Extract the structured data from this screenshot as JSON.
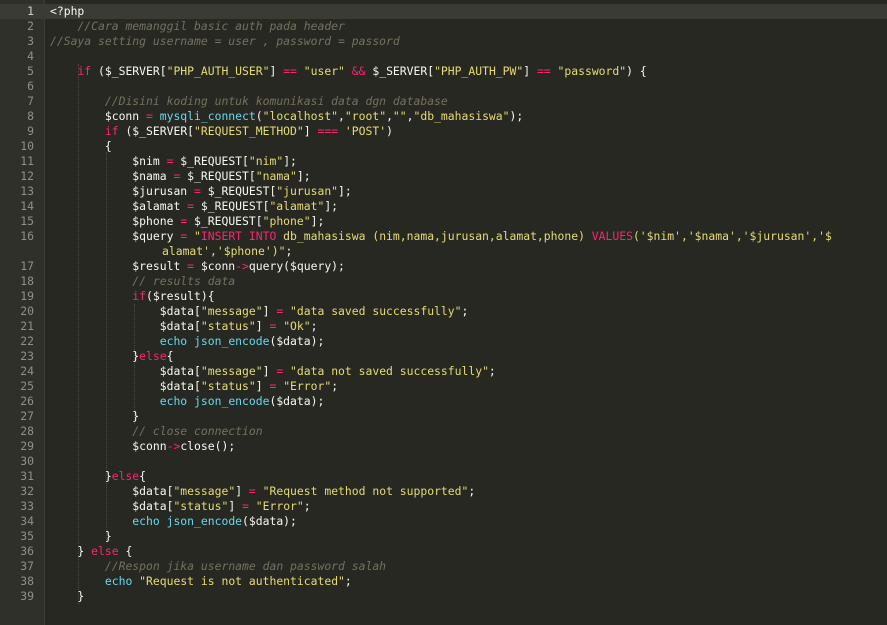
{
  "editor": {
    "lines": [
      {
        "n": "1",
        "t": [
          [
            "v",
            "<?php"
          ]
        ]
      },
      {
        "n": "2",
        "t": [
          [
            "v",
            "    "
          ],
          [
            "c",
            "//Cara memanggil basic auth pada header"
          ]
        ]
      },
      {
        "n": "3",
        "t": [
          [
            "c",
            "//Saya setting username = user , password = passord"
          ]
        ]
      },
      {
        "n": "4",
        "t": []
      },
      {
        "n": "5",
        "t": [
          [
            "v",
            "    "
          ],
          [
            "k",
            "if"
          ],
          [
            "v",
            " ($_SERVER["
          ],
          [
            "s",
            "\"PHP_AUTH_USER\""
          ],
          [
            "v",
            "] "
          ],
          [
            "k",
            "=="
          ],
          [
            "v",
            " "
          ],
          [
            "s",
            "\"user\""
          ],
          [
            "v",
            " "
          ],
          [
            "k",
            "&&"
          ],
          [
            "v",
            " $_SERVER["
          ],
          [
            "s",
            "\"PHP_AUTH_PW\""
          ],
          [
            "v",
            "] "
          ],
          [
            "k",
            "=="
          ],
          [
            "v",
            " "
          ],
          [
            "s",
            "\"password\""
          ],
          [
            "v",
            ") {"
          ]
        ]
      },
      {
        "n": "6",
        "t": []
      },
      {
        "n": "7",
        "t": [
          [
            "v",
            "        "
          ],
          [
            "c",
            "//Disini koding untuk komunikasi data dgn database"
          ]
        ]
      },
      {
        "n": "8",
        "t": [
          [
            "v",
            "        $conn "
          ],
          [
            "k",
            "="
          ],
          [
            "v",
            " "
          ],
          [
            "f",
            "mysqli_connect"
          ],
          [
            "v",
            "("
          ],
          [
            "s",
            "\"localhost\""
          ],
          [
            "v",
            ","
          ],
          [
            "s",
            "\"root\""
          ],
          [
            "v",
            ","
          ],
          [
            "s",
            "\"\""
          ],
          [
            "v",
            ","
          ],
          [
            "s",
            "\"db_mahasiswa\""
          ],
          [
            "v",
            ");"
          ]
        ]
      },
      {
        "n": "9",
        "t": [
          [
            "v",
            "        "
          ],
          [
            "k",
            "if"
          ],
          [
            "v",
            " ($_SERVER["
          ],
          [
            "s",
            "\"REQUEST_METHOD\""
          ],
          [
            "v",
            "] "
          ],
          [
            "k",
            "==="
          ],
          [
            "v",
            " "
          ],
          [
            "s",
            "'POST'"
          ],
          [
            "v",
            ")"
          ]
        ]
      },
      {
        "n": "10",
        "t": [
          [
            "v",
            "        {"
          ]
        ]
      },
      {
        "n": "11",
        "t": [
          [
            "v",
            "            $nim "
          ],
          [
            "k",
            "="
          ],
          [
            "v",
            " $_REQUEST["
          ],
          [
            "s",
            "\"nim\""
          ],
          [
            "v",
            "];"
          ]
        ]
      },
      {
        "n": "12",
        "t": [
          [
            "v",
            "            $nama "
          ],
          [
            "k",
            "="
          ],
          [
            "v",
            " $_REQUEST["
          ],
          [
            "s",
            "\"nama\""
          ],
          [
            "v",
            "];"
          ]
        ]
      },
      {
        "n": "13",
        "t": [
          [
            "v",
            "            $jurusan "
          ],
          [
            "k",
            "="
          ],
          [
            "v",
            " $_REQUEST["
          ],
          [
            "s",
            "\"jurusan\""
          ],
          [
            "v",
            "];"
          ]
        ]
      },
      {
        "n": "14",
        "t": [
          [
            "v",
            "            $alamat "
          ],
          [
            "k",
            "="
          ],
          [
            "v",
            " $_REQUEST["
          ],
          [
            "s",
            "\"alamat\""
          ],
          [
            "v",
            "];"
          ]
        ]
      },
      {
        "n": "15",
        "t": [
          [
            "v",
            "            $phone "
          ],
          [
            "k",
            "="
          ],
          [
            "v",
            " $_REQUEST["
          ],
          [
            "s",
            "\"phone\""
          ],
          [
            "v",
            "];"
          ]
        ]
      },
      {
        "n": "16",
        "t": [
          [
            "v",
            "            $query "
          ],
          [
            "k",
            "="
          ],
          [
            "v",
            " "
          ],
          [
            "s",
            "\""
          ],
          [
            "k",
            "INSERT INTO"
          ],
          [
            "s",
            " db_mahasiswa (nim,nama,jurusan,alamat,phone) "
          ],
          [
            "k",
            "VALUES"
          ],
          [
            "s",
            "('$nim','$nama','$jurusan','$"
          ]
        ],
        "wrap": [
          [
            "s",
            "alamat','$phone')\""
          ],
          [
            "v",
            ";"
          ]
        ]
      },
      {
        "n": "17",
        "t": [
          [
            "v",
            "            $result "
          ],
          [
            "k",
            "="
          ],
          [
            "v",
            " $conn"
          ],
          [
            "k",
            "->"
          ],
          [
            "v",
            "query($query);"
          ]
        ]
      },
      {
        "n": "18",
        "t": [
          [
            "v",
            "            "
          ],
          [
            "c",
            "// results data"
          ]
        ]
      },
      {
        "n": "19",
        "t": [
          [
            "v",
            "            "
          ],
          [
            "k",
            "if"
          ],
          [
            "v",
            "($result){"
          ]
        ]
      },
      {
        "n": "20",
        "t": [
          [
            "v",
            "                $data["
          ],
          [
            "s",
            "\"message\""
          ],
          [
            "v",
            "] "
          ],
          [
            "k",
            "="
          ],
          [
            "v",
            " "
          ],
          [
            "s",
            "\"data saved successfully\""
          ],
          [
            "v",
            ";"
          ]
        ]
      },
      {
        "n": "21",
        "t": [
          [
            "v",
            "                $data["
          ],
          [
            "s",
            "\"status\""
          ],
          [
            "v",
            "] "
          ],
          [
            "k",
            "="
          ],
          [
            "v",
            " "
          ],
          [
            "s",
            "\"Ok\""
          ],
          [
            "v",
            ";"
          ]
        ]
      },
      {
        "n": "22",
        "t": [
          [
            "v",
            "                "
          ],
          [
            "f",
            "echo"
          ],
          [
            "v",
            " "
          ],
          [
            "f",
            "json_encode"
          ],
          [
            "v",
            "($data);"
          ]
        ]
      },
      {
        "n": "23",
        "t": [
          [
            "v",
            "            }"
          ],
          [
            "k",
            "else"
          ],
          [
            "v",
            "{"
          ]
        ]
      },
      {
        "n": "24",
        "t": [
          [
            "v",
            "                $data["
          ],
          [
            "s",
            "\"message\""
          ],
          [
            "v",
            "] "
          ],
          [
            "k",
            "="
          ],
          [
            "v",
            " "
          ],
          [
            "s",
            "\"data not saved successfully\""
          ],
          [
            "v",
            ";"
          ]
        ]
      },
      {
        "n": "25",
        "t": [
          [
            "v",
            "                $data["
          ],
          [
            "s",
            "\"status\""
          ],
          [
            "v",
            "] "
          ],
          [
            "k",
            "="
          ],
          [
            "v",
            " "
          ],
          [
            "s",
            "\"Error\""
          ],
          [
            "v",
            ";"
          ]
        ]
      },
      {
        "n": "26",
        "t": [
          [
            "v",
            "                "
          ],
          [
            "f",
            "echo"
          ],
          [
            "v",
            " "
          ],
          [
            "f",
            "json_encode"
          ],
          [
            "v",
            "($data);"
          ]
        ]
      },
      {
        "n": "27",
        "t": [
          [
            "v",
            "            }"
          ]
        ]
      },
      {
        "n": "28",
        "t": [
          [
            "v",
            "            "
          ],
          [
            "c",
            "// close connection"
          ]
        ]
      },
      {
        "n": "29",
        "t": [
          [
            "v",
            "            $conn"
          ],
          [
            "k",
            "->"
          ],
          [
            "v",
            "close();"
          ]
        ]
      },
      {
        "n": "30",
        "t": []
      },
      {
        "n": "31",
        "t": [
          [
            "v",
            "        }"
          ],
          [
            "k",
            "else"
          ],
          [
            "v",
            "{"
          ]
        ]
      },
      {
        "n": "32",
        "t": [
          [
            "v",
            "            $data["
          ],
          [
            "s",
            "\"message\""
          ],
          [
            "v",
            "] "
          ],
          [
            "k",
            "="
          ],
          [
            "v",
            " "
          ],
          [
            "s",
            "\"Request method not supported\""
          ],
          [
            "v",
            ";"
          ]
        ]
      },
      {
        "n": "33",
        "t": [
          [
            "v",
            "            $data["
          ],
          [
            "s",
            "\"status\""
          ],
          [
            "v",
            "] "
          ],
          [
            "k",
            "="
          ],
          [
            "v",
            " "
          ],
          [
            "s",
            "\"Error\""
          ],
          [
            "v",
            ";"
          ]
        ]
      },
      {
        "n": "34",
        "t": [
          [
            "v",
            "            "
          ],
          [
            "f",
            "echo"
          ],
          [
            "v",
            " "
          ],
          [
            "f",
            "json_encode"
          ],
          [
            "v",
            "($data);"
          ]
        ]
      },
      {
        "n": "35",
        "t": [
          [
            "v",
            "        }"
          ]
        ]
      },
      {
        "n": "36",
        "t": [
          [
            "v",
            "    } "
          ],
          [
            "k",
            "else"
          ],
          [
            "v",
            " {"
          ]
        ]
      },
      {
        "n": "37",
        "t": [
          [
            "v",
            "        "
          ],
          [
            "c",
            "//Respon jika username dan password salah"
          ]
        ]
      },
      {
        "n": "38",
        "t": [
          [
            "v",
            "        "
          ],
          [
            "f",
            "echo"
          ],
          [
            "v",
            " "
          ],
          [
            "s",
            "\"Request is not authenticated\""
          ],
          [
            "v",
            ";"
          ]
        ]
      },
      {
        "n": "39",
        "t": [
          [
            "v",
            "    }"
          ]
        ]
      }
    ],
    "active_line": "1"
  },
  "colors": {
    "background": "#272822",
    "keyword": "#f92672",
    "string": "#e6db74",
    "function": "#66d9ef",
    "comment": "#75715e",
    "text": "#f8f8f2"
  }
}
